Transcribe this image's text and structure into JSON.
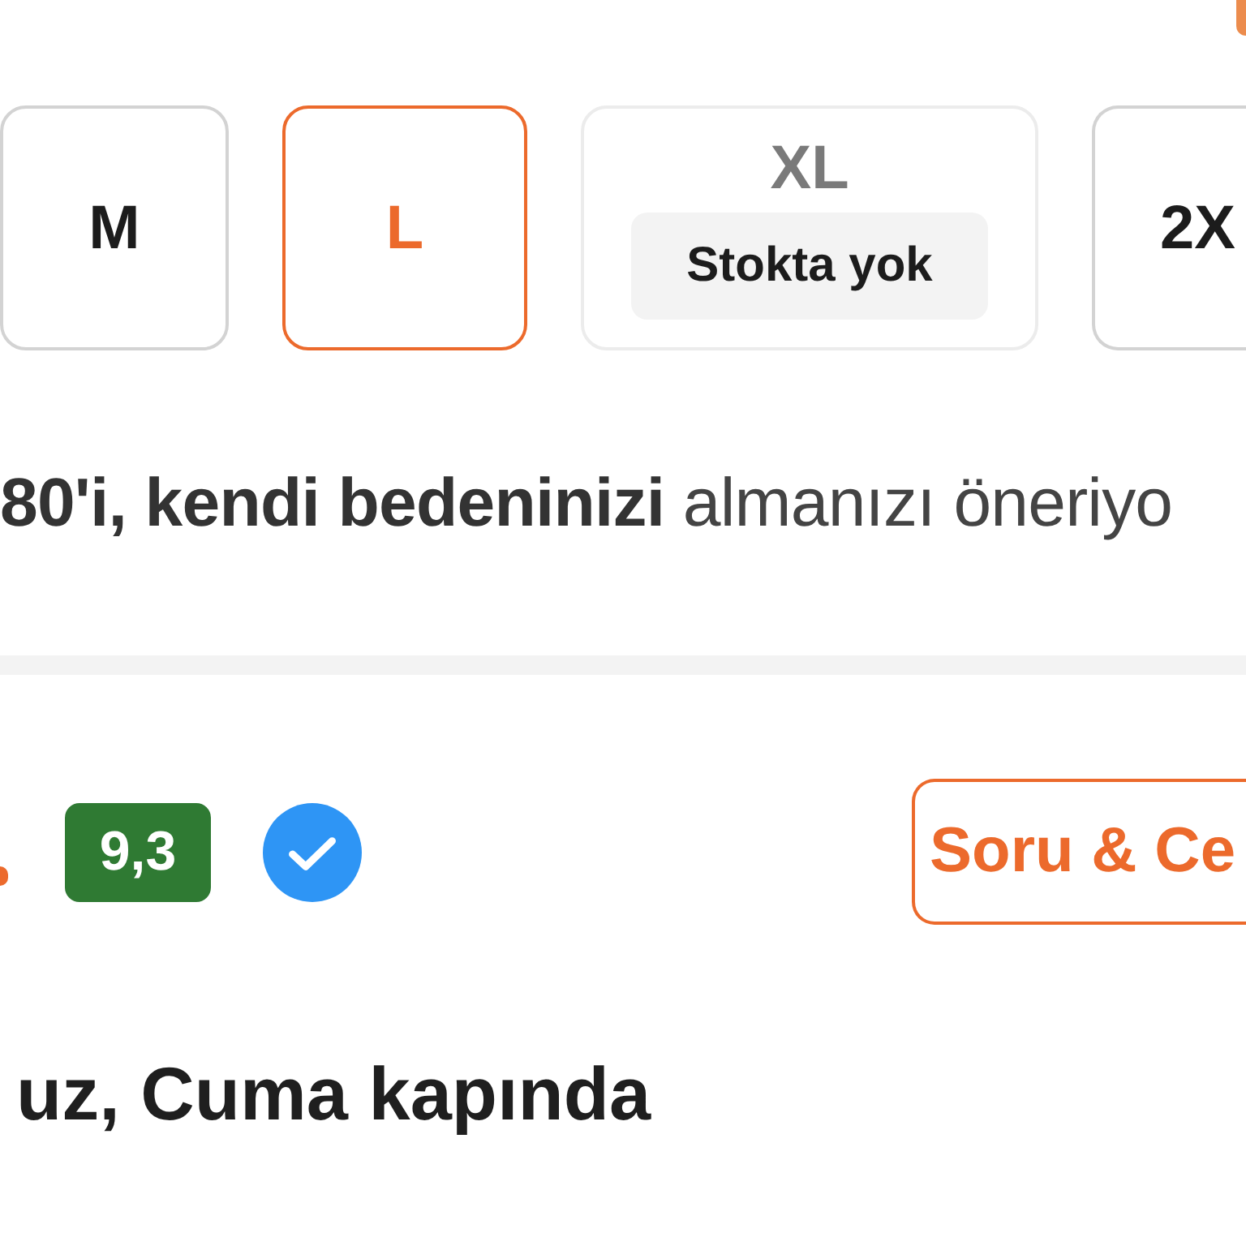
{
  "size_options": [
    {
      "label": "M",
      "selected": false,
      "in_stock": true
    },
    {
      "label": "L",
      "selected": true,
      "in_stock": true
    },
    {
      "label": "XL",
      "selected": false,
      "in_stock": false,
      "stock_note": "Stokta yok"
    },
    {
      "label": "2X",
      "selected": false,
      "in_stock": true
    }
  ],
  "size_advice": "**80'i, kendi bedeninizi** almanızı öneriyo",
  "seller": {
    "score": "9,3",
    "verified": true,
    "qa_button": "Soru & Ce"
  },
  "delivery": "uz, Cuma kapında"
}
